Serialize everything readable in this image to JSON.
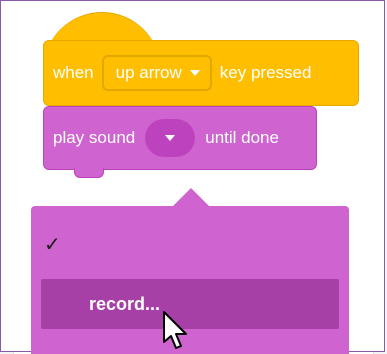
{
  "hat_block": {
    "prefix": "when",
    "key_value": "up arrow",
    "suffix": "key pressed",
    "color": "#ffbf00"
  },
  "sound_block": {
    "prefix": "play sound",
    "suffix": "until done",
    "color": "#cf63cf"
  },
  "menu": {
    "checkmark": "✓",
    "record_label": "record...",
    "highlight_color": "#a63fa6"
  }
}
